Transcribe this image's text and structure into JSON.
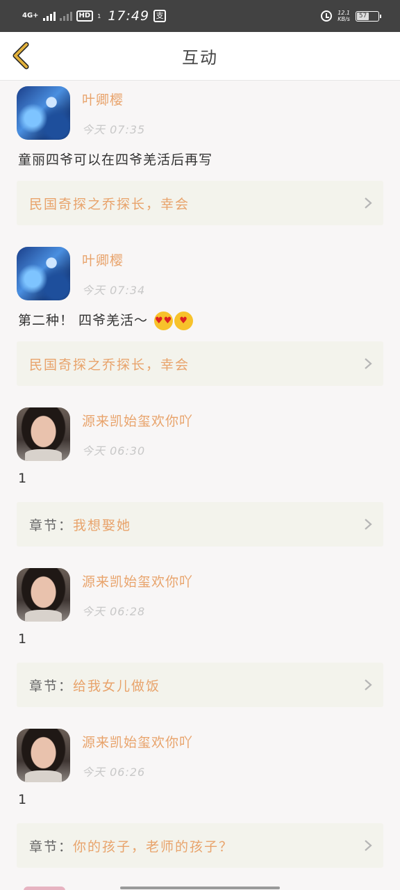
{
  "status_bar": {
    "network": "4G+",
    "hd": "HD",
    "hd_sub": "1",
    "time": "17:49",
    "app_icon": "支",
    "speed_value": "12.1",
    "speed_unit": "KB/s",
    "battery": "57"
  },
  "header": {
    "title": "互动"
  },
  "feed": [
    {
      "user": "叶卿樱",
      "time": "今天 07:35",
      "content": "童丽四爷可以在四爷羌活后再写",
      "emojis": [],
      "ref_prefix": "",
      "ref_text": "民国奇探之乔探长，幸会",
      "avatar": "anime"
    },
    {
      "user": "叶卿樱",
      "time": "今天 07:34",
      "content": "第二种！ 四爷羌活～",
      "emojis": [
        "heart-eyes-emoji",
        "kissing-face-emoji"
      ],
      "ref_prefix": "",
      "ref_text": "民国奇探之乔探长，幸会",
      "avatar": "anime"
    },
    {
      "user": "源来凯始玺欢你吖",
      "time": "今天 06:30",
      "content": "1",
      "emojis": [],
      "ref_prefix": "章节：",
      "ref_text": "我想娶她",
      "avatar": "photo"
    },
    {
      "user": "源来凯始玺欢你吖",
      "time": "今天 06:28",
      "content": "1",
      "emojis": [],
      "ref_prefix": "章节：",
      "ref_text": "给我女儿做饭",
      "avatar": "photo"
    },
    {
      "user": "源来凯始玺欢你吖",
      "time": "今天 06:26",
      "content": "1",
      "emojis": [],
      "ref_prefix": "章节：",
      "ref_text": "你的孩子，老师的孩子？",
      "avatar": "photo"
    }
  ],
  "colors": {
    "accent": "#e8a36b",
    "back_icon": "#e2b13c",
    "status_bar": "#424242",
    "ref_bg": "#f3f3ec"
  }
}
